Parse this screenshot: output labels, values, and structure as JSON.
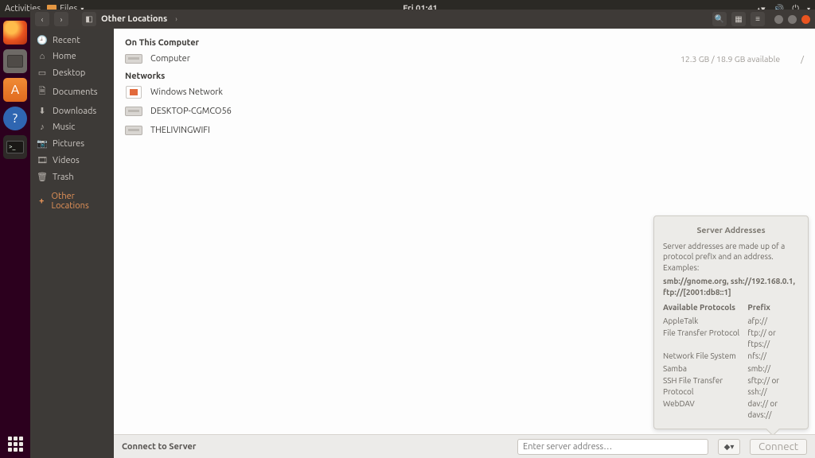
{
  "topbar": {
    "activities": "Activities",
    "app_label": "Files",
    "clock": "Fri 01:41"
  },
  "header": {
    "title": "Other Locations"
  },
  "sidebar": {
    "items": [
      {
        "icon": "🕘",
        "label": "Recent"
      },
      {
        "icon": "⌂",
        "label": "Home"
      },
      {
        "icon": "▭",
        "label": "Desktop"
      },
      {
        "icon": "🗎",
        "label": "Documents"
      },
      {
        "icon": "⬇",
        "label": "Downloads"
      },
      {
        "icon": "♪",
        "label": "Music"
      },
      {
        "icon": "📷",
        "label": "Pictures"
      },
      {
        "icon": "🎞",
        "label": "Videos"
      },
      {
        "icon": "🗑",
        "label": "Trash"
      }
    ],
    "other": {
      "icon": "+",
      "label": "Other Locations"
    }
  },
  "main": {
    "section1_title": "On This Computer",
    "computer": {
      "label": "Computer",
      "meta": "12.3 GB / 18.9 GB available",
      "path": "/"
    },
    "section2_title": "Networks",
    "networks": [
      {
        "label": "Windows Network"
      },
      {
        "label": "DESKTOP-CGMCO56"
      },
      {
        "label": "THELIVINGWIFI"
      }
    ]
  },
  "connect": {
    "label": "Connect to Server",
    "placeholder": "Enter server address…",
    "button": "Connect"
  },
  "tooltip": {
    "title": "Server Addresses",
    "desc": "Server addresses are made up of a protocol prefix and an address. Examples:",
    "examples": "smb://gnome.org, ssh://192.168.0.1, ftp://[2001:db8::1]",
    "col_protocol": "Available Protocols",
    "col_prefix": "Prefix",
    "rows": [
      {
        "p": "AppleTalk",
        "x": "afp://"
      },
      {
        "p": "File Transfer Protocol",
        "x": "ftp:// or ftps://"
      },
      {
        "p": "Network File System",
        "x": "nfs://"
      },
      {
        "p": "Samba",
        "x": "smb://"
      },
      {
        "p": "SSH File Transfer Protocol",
        "x": "sftp:// or ssh://"
      },
      {
        "p": "WebDAV",
        "x": "dav:// or davs://"
      }
    ]
  }
}
